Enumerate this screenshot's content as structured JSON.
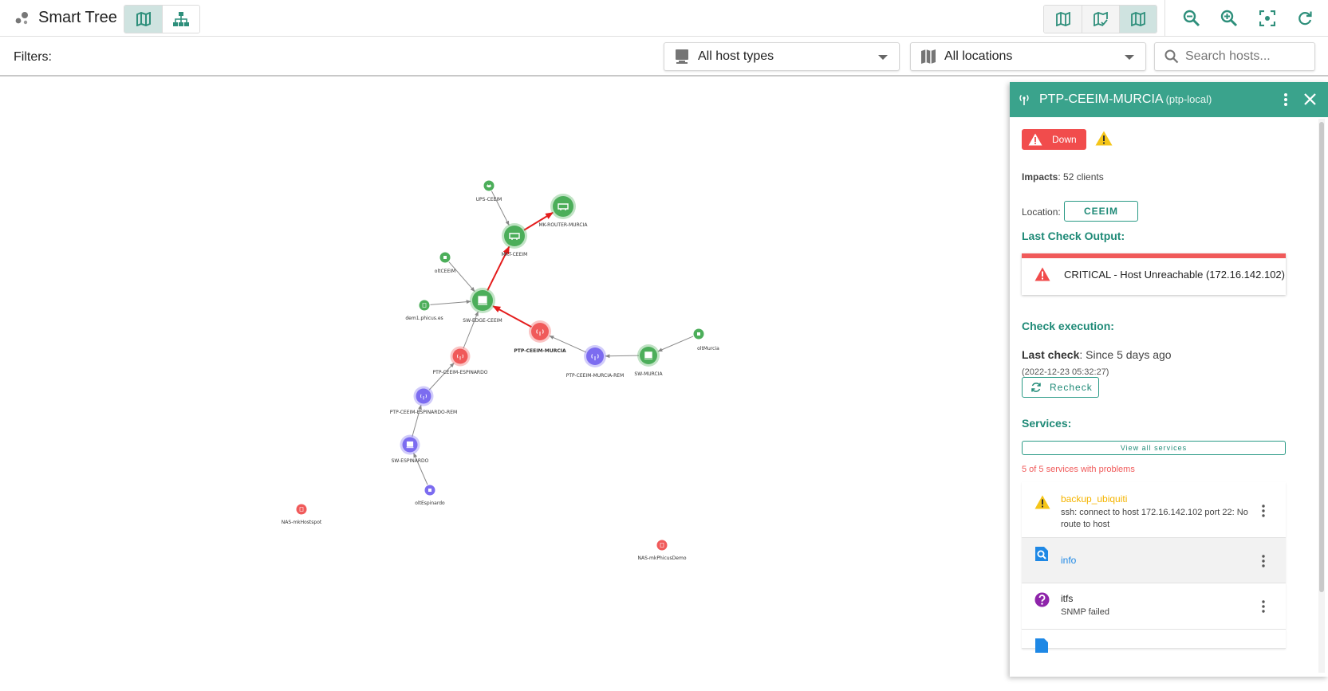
{
  "app": {
    "title": "Smart Tree"
  },
  "toolbar": {
    "views": [
      {
        "name": "map-view",
        "icon": "map-icon",
        "active": true
      },
      {
        "name": "hierarchy-view",
        "icon": "sitemap-icon",
        "active": false
      }
    ],
    "layers": [
      {
        "icon": "map-icon",
        "active": false
      },
      {
        "icon": "map-check-icon",
        "active": false
      },
      {
        "icon": "map-outline-icon",
        "active": true
      }
    ],
    "tools": [
      "zoom-out-icon",
      "zoom-in-icon",
      "fit-view-icon",
      "refresh-icon"
    ]
  },
  "filters": {
    "label": "Filters:",
    "host_types": "All host types",
    "locations": "All locations",
    "search_placeholder": "Search hosts..."
  },
  "colors": {
    "accent": "#3aa38c",
    "up": "#4cae5a",
    "down": "#f05a5a",
    "unreachable": "#7c6cf0",
    "warning": "#f5c518",
    "critical_edge": "#e41c1c"
  },
  "graph": {
    "nodes": [
      {
        "id": "UPS-CEEIM",
        "label": "UPS-CEEIM",
        "status": "up",
        "icon": "plug-icon"
      },
      {
        "id": "MK-ROUTER-MURCIA",
        "label": "MK-ROUTER-MURCIA",
        "status": "up",
        "icon": "router-icon"
      },
      {
        "id": "MKT-CEEIM",
        "label": "MKT-CEEIM",
        "status": "up",
        "icon": "router-icon"
      },
      {
        "id": "oltCEEIM",
        "label": "oltCEEIM",
        "status": "up",
        "icon": "device-icon"
      },
      {
        "id": "demo1",
        "label": "dem1.phicus.es",
        "status": "up",
        "icon": "server-icon"
      },
      {
        "id": "SW-EDGE-CEEIM",
        "label": "SW-EDGE-CEEIM",
        "status": "up",
        "icon": "switch-icon"
      },
      {
        "id": "PTP-CEEIM-MURCIA",
        "label": "PTP-CEEIM-MURCIA",
        "status": "down",
        "icon": "antenna-icon",
        "selected": true
      },
      {
        "id": "PTP-CEEIM-MURCIA-REM",
        "label": "PTP-CEEIM-MURCIA-REM",
        "status": "unreachable",
        "icon": "antenna-icon"
      },
      {
        "id": "SW-MURCIA",
        "label": "SW-MURCIA",
        "status": "up",
        "icon": "switch-icon"
      },
      {
        "id": "oltMurcia",
        "label": "oltMurcia",
        "status": "up",
        "icon": "device-icon"
      },
      {
        "id": "PTP-CEEIM-ESPINARDO",
        "label": "PTP-CEEIM-ESPINARDO",
        "status": "down",
        "icon": "antenna-icon"
      },
      {
        "id": "PTP-CEEIM-ESPINARDO-REM",
        "label": "PTP-CEEIM-ESPINARDO-REM",
        "status": "unreachable",
        "icon": "antenna-icon"
      },
      {
        "id": "SW-ESPINARDO",
        "label": "SW-ESPINARDO",
        "status": "unreachable",
        "icon": "switch-icon"
      },
      {
        "id": "oltEspinardo",
        "label": "oltEspinardo",
        "status": "unreachable",
        "icon": "device-icon"
      },
      {
        "id": "NAS-mkHostspot",
        "label": "NAS-mkHostspot",
        "status": "down",
        "icon": "server-icon"
      },
      {
        "id": "NAS-mkPhicusDemo",
        "label": "NAS-mkPhicusDemo",
        "status": "down",
        "icon": "server-icon"
      }
    ],
    "edges": [
      {
        "from": "UPS-CEEIM",
        "to": "MKT-CEEIM",
        "critical": false
      },
      {
        "from": "MKT-CEEIM",
        "to": "MK-ROUTER-MURCIA",
        "critical": true
      },
      {
        "from": "SW-EDGE-CEEIM",
        "to": "MKT-CEEIM",
        "critical": true
      },
      {
        "from": "oltCEEIM",
        "to": "SW-EDGE-CEEIM",
        "critical": false
      },
      {
        "from": "demo1",
        "to": "SW-EDGE-CEEIM",
        "critical": false
      },
      {
        "from": "PTP-CEEIM-MURCIA",
        "to": "SW-EDGE-CEEIM",
        "critical": true
      },
      {
        "from": "PTP-CEEIM-MURCIA-REM",
        "to": "PTP-CEEIM-MURCIA",
        "critical": false
      },
      {
        "from": "SW-MURCIA",
        "to": "PTP-CEEIM-MURCIA-REM",
        "critical": false
      },
      {
        "from": "oltMurcia",
        "to": "SW-MURCIA",
        "critical": false
      },
      {
        "from": "PTP-CEEIM-ESPINARDO",
        "to": "SW-EDGE-CEEIM",
        "critical": false
      },
      {
        "from": "PTP-CEEIM-ESPINARDO-REM",
        "to": "PTP-CEEIM-ESPINARDO",
        "critical": false
      },
      {
        "from": "SW-ESPINARDO",
        "to": "PTP-CEEIM-ESPINARDO-REM",
        "critical": false
      },
      {
        "from": "oltEspinardo",
        "to": "SW-ESPINARDO",
        "critical": false
      }
    ]
  },
  "panel": {
    "title": "PTP-CEEIM-MURCIA",
    "subtitle": "(ptp-local)",
    "status": "Down",
    "impacts_label": "Impacts",
    "impacts_value": ": 52 clients",
    "location_label": "Location:",
    "location": "CEEIM",
    "last_check_output_title": "Last Check Output:",
    "output_text": "CRITICAL - Host Unreachable (172.16.142.102)",
    "check_execution_title": "Check execution:",
    "last_check_label": "Last check",
    "last_check_value": ": Since 5 days ago",
    "last_check_date": "(2022-12-23 05:32:27)",
    "recheck_label": "Recheck",
    "services_title": "Services:",
    "view_all_label": "View all services",
    "problems_text": "5 of 5 services with problems",
    "services": [
      {
        "name": "backup_ubiquiti",
        "output": "ssh: connect to host 172.16.142.102 port 22: No route to host",
        "icon": "warning-icon",
        "name_color": "#f5b400"
      },
      {
        "name": "info",
        "output": "",
        "icon": "info-search-icon",
        "name_color": "#1e88e5"
      },
      {
        "name": "itfs",
        "output": "SNMP failed",
        "icon": "question-icon",
        "name_color": "#222222"
      }
    ]
  }
}
